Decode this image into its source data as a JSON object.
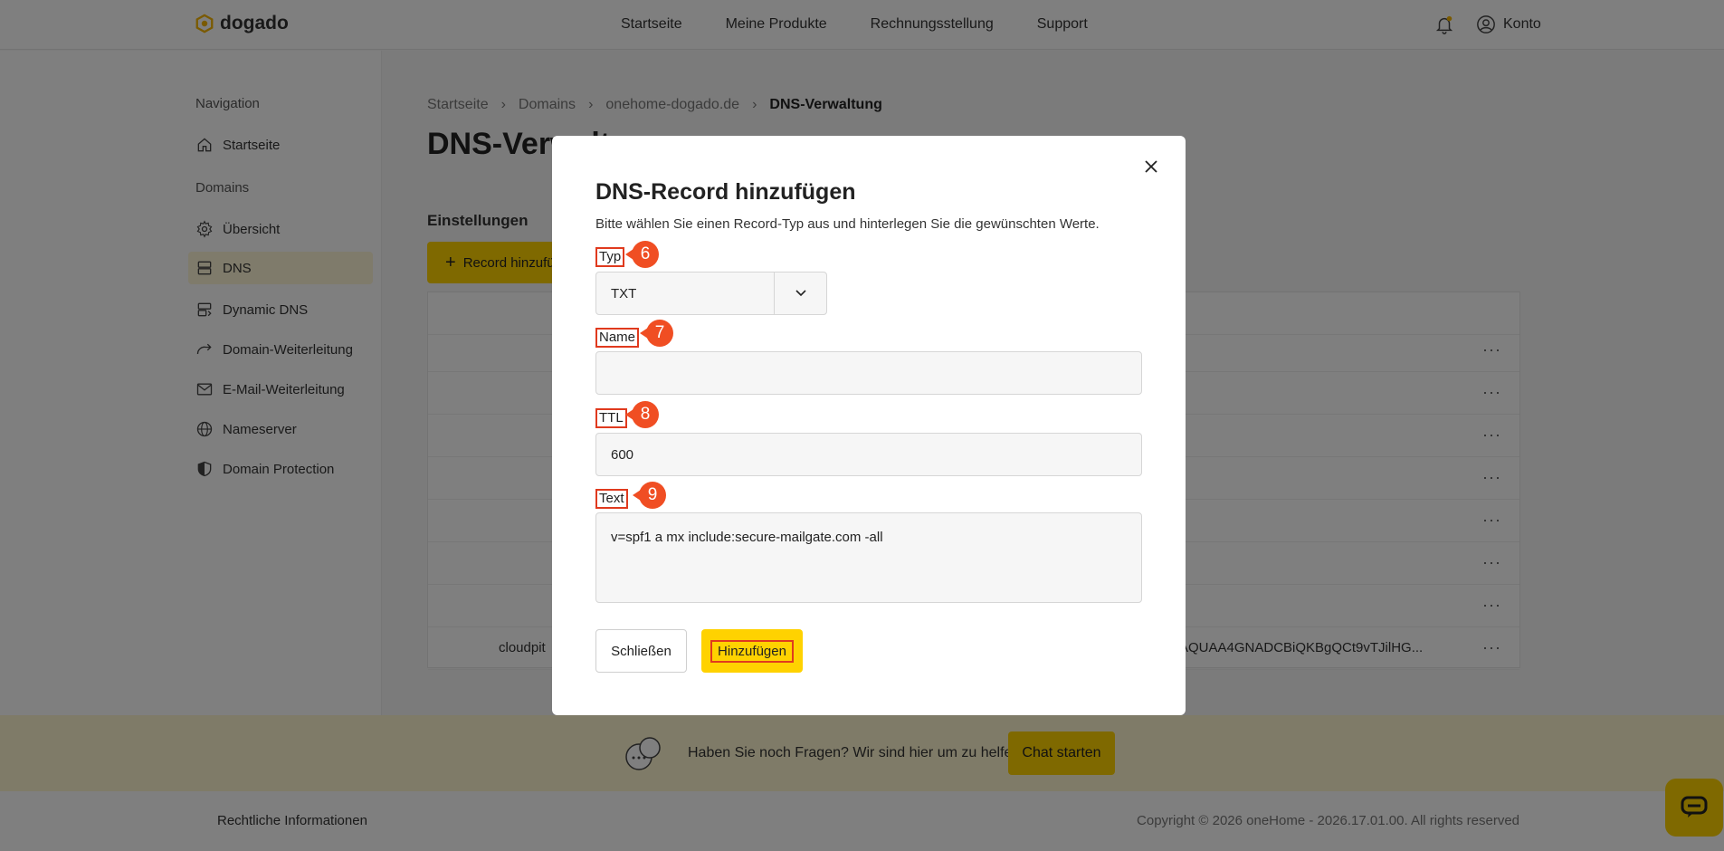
{
  "header": {
    "brand": "dogado",
    "nav": [
      "Startseite",
      "Meine Produkte",
      "Rechnungsstellung",
      "Support"
    ],
    "account_label": "Konto"
  },
  "sidebar": {
    "section_navigation": "Navigation",
    "home": "Startseite",
    "section_domains": "Domains",
    "items": [
      "Übersicht",
      "DNS",
      "Dynamic DNS",
      "Domain-Weiterleitung",
      "E-Mail-Weiterleitung",
      "Nameserver",
      "Domain Protection"
    ]
  },
  "breadcrumb": [
    "Startseite",
    "Domains",
    "onehome-dogado.de",
    "DNS-Verwaltung"
  ],
  "page_title": "DNS-Verwaltung",
  "settings_label": "Einstellungen",
  "add_record_label": "Record hinzufügen",
  "table": {
    "last_row_left": "cloudpit",
    "last_row_right": "AQUAA4GNADCBiQKBgQCt9vTJilHG..."
  },
  "help": {
    "text": "Haben Sie noch Fragen? Wir sind hier um zu helfen.",
    "chat_button": "Chat starten"
  },
  "footer": {
    "legal": "Rechtliche Informationen",
    "copyright": "Copyright © 2026 oneHome - 2026.17.01.00. All rights reserved"
  },
  "modal": {
    "title": "DNS-Record hinzufügen",
    "subtitle": "Bitte wählen Sie einen Record-Typ aus und hinterlegen Sie die gewünschten Werte.",
    "type_label": "Typ",
    "type_badge": "6",
    "type_value": "TXT",
    "name_label": "Name",
    "name_badge": "7",
    "name_value": "",
    "ttl_label": "TTL",
    "ttl_badge": "8",
    "ttl_value": "600",
    "text_label": "Text",
    "text_badge": "9",
    "text_value": "v=spf1 a mx include:secure-mailgate.com -all",
    "close_label": "Schließen",
    "add_label": "Hinzufügen"
  },
  "colors": {
    "accent": "#ffd200",
    "annotation": "#f04e23"
  }
}
